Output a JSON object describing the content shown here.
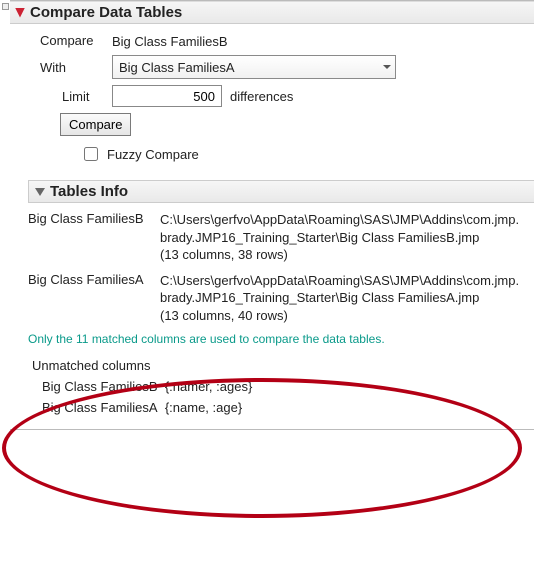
{
  "headers": {
    "main": "Compare Data Tables",
    "sub": "Tables Info"
  },
  "compare": {
    "compare_label": "Compare",
    "compare_value": "Big Class FamiliesB",
    "with_label": "With",
    "with_value": "Big Class FamiliesA",
    "limit_label": "Limit",
    "limit_value": "500",
    "limit_suffix": "differences",
    "button": "Compare",
    "fuzzy_label": "Fuzzy Compare"
  },
  "tables": [
    {
      "name": "Big Class FamiliesB",
      "path": "C:\\Users\\gerfvo\\AppData\\Roaming\\SAS\\JMP\\Addins\\com.jmp.brady.JMP16_Training_Starter\\Big Class FamiliesB.jmp",
      "meta": "(13 columns, 38 rows)"
    },
    {
      "name": "Big Class FamiliesA",
      "path": "C:\\Users\\gerfvo\\AppData\\Roaming\\SAS\\JMP\\Addins\\com.jmp.brady.JMP16_Training_Starter\\Big Class FamiliesA.jmp",
      "meta": "(13 columns, 40 rows)"
    }
  ],
  "note": "Only the 11 matched columns are used to compare the data tables.",
  "unmatched": {
    "title": "Unmatched columns",
    "rows": [
      {
        "name": "Big Class FamiliesB",
        "cols": "{:namer, :ages}"
      },
      {
        "name": "Big Class FamiliesA",
        "cols": "{:name, :age}"
      }
    ]
  }
}
